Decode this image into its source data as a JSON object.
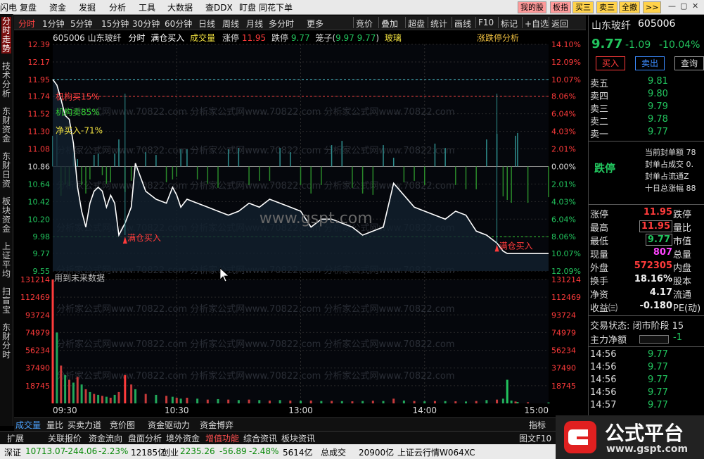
{
  "menu": [
    "闪电",
    "复盘",
    "资金",
    "发掘",
    "分析",
    "工具",
    "大数据",
    "查DDX",
    "盯盘",
    "同花下单"
  ],
  "menu_buttons": [
    {
      "label": "我的股",
      "bg": "#ff9a9a"
    },
    {
      "label": "板指",
      "bg": "#ff9a9a"
    },
    {
      "label": "买三",
      "bg": "#ffd24a"
    },
    {
      "label": "卖三",
      "bg": "#ffd24a"
    },
    {
      "label": "全撤",
      "bg": "#ffd24a"
    },
    {
      "label": ">>",
      "bg": "#ffd24a"
    }
  ],
  "toolbar": [
    "分时",
    "1分钟",
    "5分钟",
    "15分钟",
    "30分钟",
    "60分钟",
    "日线",
    "周线",
    "月线",
    "多分时",
    "更多",
    "竞价",
    "叠加",
    "超盘",
    "统计",
    "画线",
    "F10",
    "标记",
    "+自选",
    "返回"
  ],
  "left_tabs": [
    "分时走势",
    "技术分析",
    "东财资金",
    "东财日资",
    "板块资金",
    "上证平均",
    "扫盲宝",
    "东财分时"
  ],
  "info": {
    "code": "605006 山东玻纤",
    "mode": "分时",
    "buy_label": "满仓买入",
    "vol_label": "成交量",
    "zhangting_label": "涨停",
    "zhangting": "11.95",
    "dieting_label": "跌停",
    "dieting": "9.77",
    "cage_label": "笼子(",
    "cage_lo": "9.97",
    "cage_hi": "9.77",
    "cage_close": ")",
    "tag": "玻璃",
    "analysis": "涨跌停分析"
  },
  "annotations": {
    "jg_buy": "机构买15%",
    "jg_sell": "机构卖85%",
    "net_buy": "净买入-71%",
    "future": "用到未来数据",
    "buy_marker": "满仓买入",
    "watermark_url": "www.gspt.com"
  },
  "watermark_row": "分析家公式网www.70822.com  分析家公式网www.70822.com  分析家公式网www.70822.com",
  "axes": {
    "price_ticks": [
      "12.39",
      "12.17",
      "11.95",
      "11.74",
      "11.52",
      "11.30",
      "11.08",
      "10.86",
      "10.64",
      "10.42",
      "10.20",
      "9.98",
      "9.77",
      "9.55"
    ],
    "pct_ticks": [
      "14.10%",
      "12.09%",
      "10.07%",
      "8.06%",
      "6.04%",
      "4.03%",
      "2.01%",
      "0.00%",
      "2.01%",
      "4.03%",
      "6.04%",
      "8.06%",
      "10.07%",
      "12.09%"
    ],
    "vol_ticks": [
      "131214",
      "112469",
      "93724",
      "74979",
      "56234",
      "37490",
      "18745"
    ],
    "time_ticks": [
      "09:30",
      "10:30",
      "13:00",
      "14:00",
      "15:00"
    ]
  },
  "chart_data": {
    "type": "line",
    "title": "",
    "xlabel": "",
    "ylabel": "",
    "ylim": [
      9.55,
      12.39
    ],
    "prev_close": 10.86,
    "x": [
      0,
      2,
      4,
      6,
      8,
      10,
      12,
      14,
      16,
      18,
      20,
      22,
      24,
      26,
      28,
      30,
      32,
      35,
      38,
      40,
      45,
      50,
      55,
      58,
      60,
      62,
      65,
      70,
      75,
      80,
      85,
      90,
      95,
      100,
      105,
      110,
      115,
      120,
      125,
      130,
      135,
      140,
      145,
      150,
      155,
      160,
      165,
      170,
      175,
      180,
      185,
      190,
      195,
      200,
      205,
      210,
      215,
      218,
      220,
      222,
      224,
      225,
      230,
      240
    ],
    "series": [
      {
        "values": [
          11.95,
          11.88,
          11.7,
          11.5,
          11.45,
          11.15,
          10.6,
          10.3,
          10.1,
          10.4,
          10.55,
          10.6,
          10.55,
          10.35,
          10.5,
          10.4,
          10.0,
          10.15,
          10.35,
          10.9,
          10.55,
          10.45,
          10.4,
          10.6,
          10.5,
          10.35,
          10.45,
          10.4,
          10.35,
          10.3,
          10.25,
          10.3,
          10.4,
          10.35,
          10.45,
          10.4,
          10.35,
          10.3,
          10.1,
          10.2,
          10.2,
          10.15,
          10.1,
          10.0,
          10.05,
          10.1,
          10.65,
          10.5,
          10.35,
          10.3,
          10.25,
          10.2,
          10.3,
          10.25,
          10.05,
          10.0,
          9.9,
          9.8,
          9.77,
          9.77,
          9.77,
          9.77,
          9.77,
          9.77
        ]
      }
    ],
    "volume": [
      131214,
      75000,
      40000,
      30000,
      25000,
      22000,
      28000,
      20000,
      15000,
      12000,
      10000,
      9000,
      8000,
      7000,
      6000,
      9000,
      12000,
      30000,
      20000,
      15000,
      10000,
      9000,
      8000,
      7000,
      6000,
      5000,
      6000,
      5000,
      4000,
      4500,
      4000,
      3500,
      4000,
      3500,
      3000,
      3500,
      3000,
      2800,
      3000,
      2500,
      2600,
      2400,
      2200,
      2500,
      2800,
      2500,
      5000,
      3000,
      2500,
      2200,
      2500,
      2400,
      2200,
      2000,
      2500,
      3500,
      4000,
      5000,
      25000,
      3000,
      2000,
      1500,
      1200,
      1000
    ],
    "volume_ylim": [
      0,
      131214
    ]
  },
  "right": {
    "name": "山东玻纤",
    "code": "605006",
    "price": "9.77",
    "chg": "-1.09",
    "pct": "-10.04%",
    "buy": "买入",
    "sell": "卖出",
    "query": "查询",
    "asks": [
      {
        "label": "卖五",
        "price": "9.81"
      },
      {
        "label": "卖四",
        "price": "9.80"
      },
      {
        "label": "卖三",
        "price": "9.79"
      },
      {
        "label": "卖二",
        "price": "9.78"
      },
      {
        "label": "卖一",
        "price": "9.77"
      }
    ],
    "limit_title": "跌停",
    "limit_lines": [
      "当前封单额 78",
      "封单占成交 0.",
      "封单占流通Z",
      "十日总涨幅 88"
    ],
    "quote_rows": [
      {
        "l1": "涨停",
        "v1": "11.95",
        "l2": "跌停",
        "c1": "red"
      },
      {
        "l1": "最高",
        "v1": "11.95",
        "l2": "量比",
        "c1": "red"
      },
      {
        "l1": "最低",
        "v1": "9.77",
        "l2": "市值",
        "c1": "green"
      },
      {
        "l1": "现量",
        "v1": "807",
        "l2": "总量",
        "c1": "purple"
      },
      {
        "l1": "外盘",
        "v1": "572305",
        "l2": "内盘",
        "c1": "red"
      },
      {
        "l1": "换手",
        "v1": "18.16%",
        "l2": "股本",
        "c1": "white"
      },
      {
        "l1": "净资",
        "v1": "4.17",
        "l2": "流通",
        "c1": "white"
      },
      {
        "l1": "收益㈢",
        "v1": "-0.180",
        "l2": "PE(动)",
        "c1": "white"
      }
    ],
    "state": "交易状态: 闭市阶段 15",
    "main_net": "主力净额",
    "main_net_val": "-1",
    "ticks": [
      {
        "t": "14:56",
        "p": "9.77"
      },
      {
        "t": "14:56",
        "p": "9.77"
      },
      {
        "t": "14:56",
        "p": "9.77"
      },
      {
        "t": "14:56",
        "p": "9.77"
      },
      {
        "t": "14:57",
        "p": "9.77"
      }
    ]
  },
  "bottom_tabs": [
    "成交量",
    "量比",
    "买卖力道",
    "竞价图",
    "资金驱动力",
    "资金博弈"
  ],
  "bottom_right": "指标",
  "bottom_tabs2": [
    "扩展",
    "关联报价",
    "资金流向",
    "盘面分析",
    "境外资金",
    "增值功能",
    "综合资讯",
    "板块资讯"
  ],
  "bottom_tabs2_right": "图文F10",
  "status": {
    "sz_label": "深证",
    "sz_val": "10713.07",
    "sz_chg": "-244.06",
    "sz_pct": "-2.23%",
    "sz_amt": "12185亿",
    "cy_label": "创业",
    "cy_val": "2235.26",
    "cy_chg": "-56.89",
    "cy_pct": "-2.48%",
    "cy_amt": "5614亿",
    "total_label": "总成交",
    "total": "20900亿",
    "server": "上证云行情W064XC"
  },
  "logo": {
    "big": "公式平台",
    "small": "www.gspt.com"
  }
}
